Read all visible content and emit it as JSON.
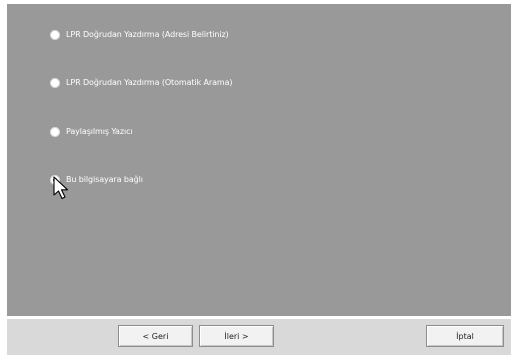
{
  "options": [
    {
      "label": "LPR Doğrudan Yazdırma (Adresi Belirtiniz)",
      "selected": false
    },
    {
      "label": "LPR Doğrudan Yazdırma (Otomatik Arama)",
      "selected": false
    },
    {
      "label": "Paylaşılmış Yazıcı",
      "selected": false
    },
    {
      "label": "Bu bilgisayara bağlı",
      "selected": true
    }
  ],
  "buttons": {
    "back": "< Geri",
    "next": "İleri >",
    "cancel": "İptal"
  },
  "colors": {
    "panel_background": "#999999",
    "footer_background": "#d9d9d9",
    "option_text": "#ffffff"
  }
}
